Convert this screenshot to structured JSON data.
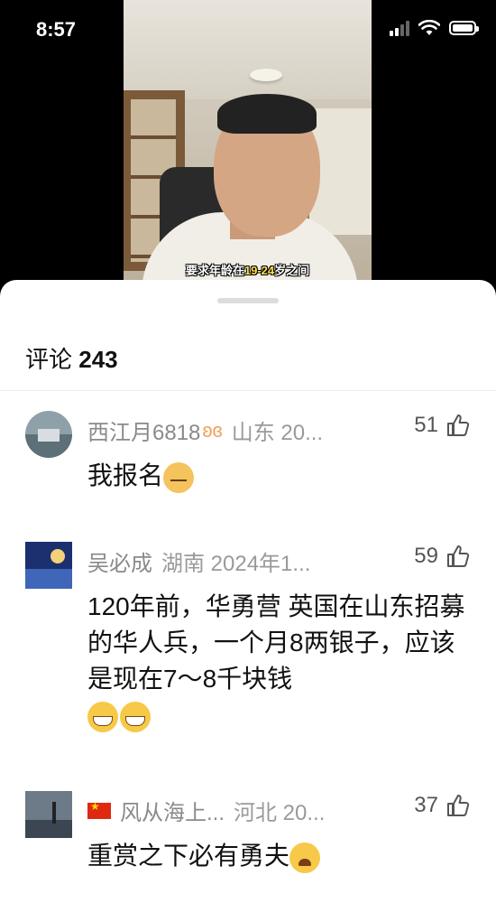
{
  "status_bar": {
    "time": "8:57"
  },
  "video": {
    "subtitle_prefix": "要求年龄在",
    "subtitle_highlight": "19-24",
    "subtitle_suffix": "岁之间"
  },
  "comments_panel": {
    "title": "评论",
    "count": "243",
    "comments": [
      {
        "nickname": "西江月6818",
        "badge": "ʚɞ",
        "location": "山东 20...",
        "likes": "51",
        "text": "我报名",
        "emojis": [
          "cat-face-emoji"
        ]
      },
      {
        "nickname": "吴必成",
        "location": "湖南 2024年1...",
        "likes": "59",
        "text": "120年前，华勇营 英国在山东招募的华人兵，一个月8两银子，应该是现在7～8千块钱",
        "emojis": [
          "grin-emoji",
          "grin-emoji"
        ]
      },
      {
        "nickname": "风从海上...",
        "flag": "china-flag",
        "location": "河北 20...",
        "likes": "37",
        "text": "重赏之下必有勇夫",
        "emojis": [
          "crying-laughing-emoji"
        ]
      }
    ]
  }
}
